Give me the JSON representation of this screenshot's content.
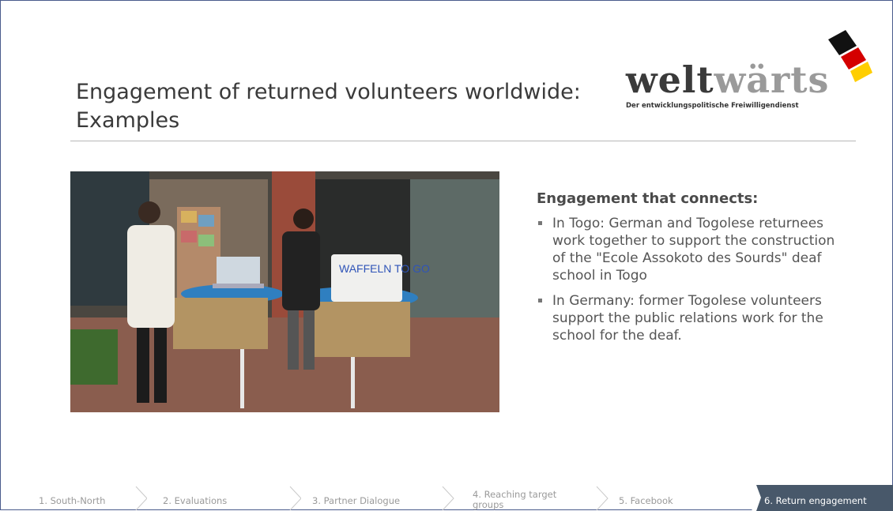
{
  "slide": {
    "title": "Engagement of returned volunteers worldwide: Examples"
  },
  "logo": {
    "word_main": "welt",
    "word_accent": "wärts",
    "subtitle": "Der entwicklungspolitische Freiwilligendienst",
    "flag_colors": [
      "#000000",
      "#dd0000",
      "#ffce00"
    ]
  },
  "content": {
    "heading": "Engagement that connects:",
    "bullets": [
      "In Togo: German and Togolese returnees work together to support the construction of the \"Ecole Assokoto des Sourds\" deaf school in Togo",
      "In Germany: former Togolese volunteers support the public relations work for the school for the deaf."
    ]
  },
  "photo": {
    "sign_text": "WAFFELN TO GO"
  },
  "nav": {
    "items": [
      {
        "label": "1. South-North",
        "active": false
      },
      {
        "label": "2. Evaluations",
        "active": false
      },
      {
        "label": "3. Partner Dialogue",
        "active": false
      },
      {
        "label": "4. Reaching target groups",
        "active": false
      },
      {
        "label": "5. Facebook",
        "active": false
      },
      {
        "label": "6. Return engagement",
        "active": true
      }
    ],
    "active_color": "#48586a"
  }
}
